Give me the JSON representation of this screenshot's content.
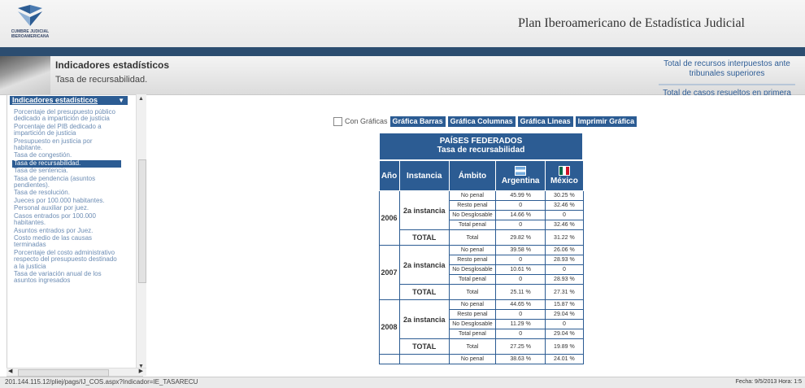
{
  "header": {
    "logo_text": "CUMBRE JUDICIAL IBEROAMERICANA",
    "site_title": "Plan Iberoamericano de Estadística Judicial"
  },
  "banner": {
    "title": "Indicadores estadísticos",
    "subtitle": "Tasa de recursabilidad.",
    "right_link_1": "Total de recursos interpuestos ante tribunales superiores",
    "right_link_2": "Total de casos resueltos en primera"
  },
  "sidebar": {
    "header": "Indicadores estadísticos",
    "items": [
      {
        "label": "Porcentaje del presupuesto público dedicado a impartición de justicia",
        "active": false
      },
      {
        "label": "Porcentaje del PIB dedicado a impartición de justicia",
        "active": false
      },
      {
        "label": "Presupuesto en justicia por habitante.",
        "active": false
      },
      {
        "label": "Tasa de congestión.",
        "active": false
      },
      {
        "label": "Tasa de recursabilidad.",
        "active": true
      },
      {
        "label": "Tasa de sentencia.",
        "active": false
      },
      {
        "label": "Tasa de pendencia (asuntos pendientes).",
        "active": false
      },
      {
        "label": "Tasa de resolución.",
        "active": false
      },
      {
        "label": "Jueces por 100.000 habitantes.",
        "active": false
      },
      {
        "label": "Personal auxiliar por juez.",
        "active": false
      },
      {
        "label": "Casos entrados por 100.000 habitantes.",
        "active": false
      },
      {
        "label": "Asuntos entrados por Juez.",
        "active": false
      },
      {
        "label": "Costo medio de las causas terminadas",
        "active": false
      },
      {
        "label": "Porcentaje del costo administrativo respecto del presupuesto destinado a la justicia",
        "active": false
      },
      {
        "label": "Tasa de variación anual de los asuntos ingresados",
        "active": false
      }
    ]
  },
  "toolbar": {
    "checkbox_label": "Con Gráficas",
    "buttons": [
      "Gráfica Barras",
      "Gráfica Columnas",
      "Gráfica Lineas",
      "Imprimir Gráfica"
    ]
  },
  "table": {
    "title": "PAÍSES FEDERADOS",
    "subtitle": "Tasa de recursabilidad",
    "headers": {
      "year": "Año",
      "instance": "Instancia",
      "scope": "Ámbito",
      "country1": "Argentina",
      "country2": "México"
    },
    "instance_label": "2a instancia",
    "total_label": "TOTAL",
    "total_scope": "Total",
    "years": [
      {
        "year": "2006",
        "rows": [
          {
            "scope": "No penal",
            "argentina": "45.99 %",
            "mexico": "30.25 %"
          },
          {
            "scope": "Resto penal",
            "argentina": "0",
            "mexico": "32.46 %"
          },
          {
            "scope": "No Desglosable",
            "argentina": "14.66 %",
            "mexico": "0"
          },
          {
            "scope": "Total penal",
            "argentina": "0",
            "mexico": "32.46 %"
          }
        ],
        "total": {
          "argentina": "29.82 %",
          "mexico": "31.22 %"
        }
      },
      {
        "year": "2007",
        "rows": [
          {
            "scope": "No penal",
            "argentina": "39.58 %",
            "mexico": "26.06 %"
          },
          {
            "scope": "Resto penal",
            "argentina": "0",
            "mexico": "28.93 %"
          },
          {
            "scope": "No Desglosable",
            "argentina": "10.61 %",
            "mexico": "0"
          },
          {
            "scope": "Total penal",
            "argentina": "0",
            "mexico": "28.93 %"
          }
        ],
        "total": {
          "argentina": "25.11 %",
          "mexico": "27.31 %"
        }
      },
      {
        "year": "2008",
        "rows": [
          {
            "scope": "No penal",
            "argentina": "44.65 %",
            "mexico": "15.87 %"
          },
          {
            "scope": "Resto penal",
            "argentina": "0",
            "mexico": "29.04 %"
          },
          {
            "scope": "No Desglosable",
            "argentina": "11.29 %",
            "mexico": "0"
          },
          {
            "scope": "Total penal",
            "argentina": "0",
            "mexico": "29.04 %"
          }
        ],
        "total": {
          "argentina": "27.25 %",
          "mexico": "19.89 %"
        }
      }
    ],
    "partial_row": {
      "scope": "No penal",
      "argentina": "38.63 %",
      "mexico": "24.01 %"
    }
  },
  "statusbar": {
    "url": "201.144.115.12/pliej/pags/IJ_COS.aspx?Indicador=IE_TASARECU",
    "datetime": "Fecha: 9/5/2013 Hora: 1:5"
  },
  "colors": {
    "accent": "#2c5c93",
    "topbar": "#2c4d70",
    "link": "#6d8db4"
  }
}
